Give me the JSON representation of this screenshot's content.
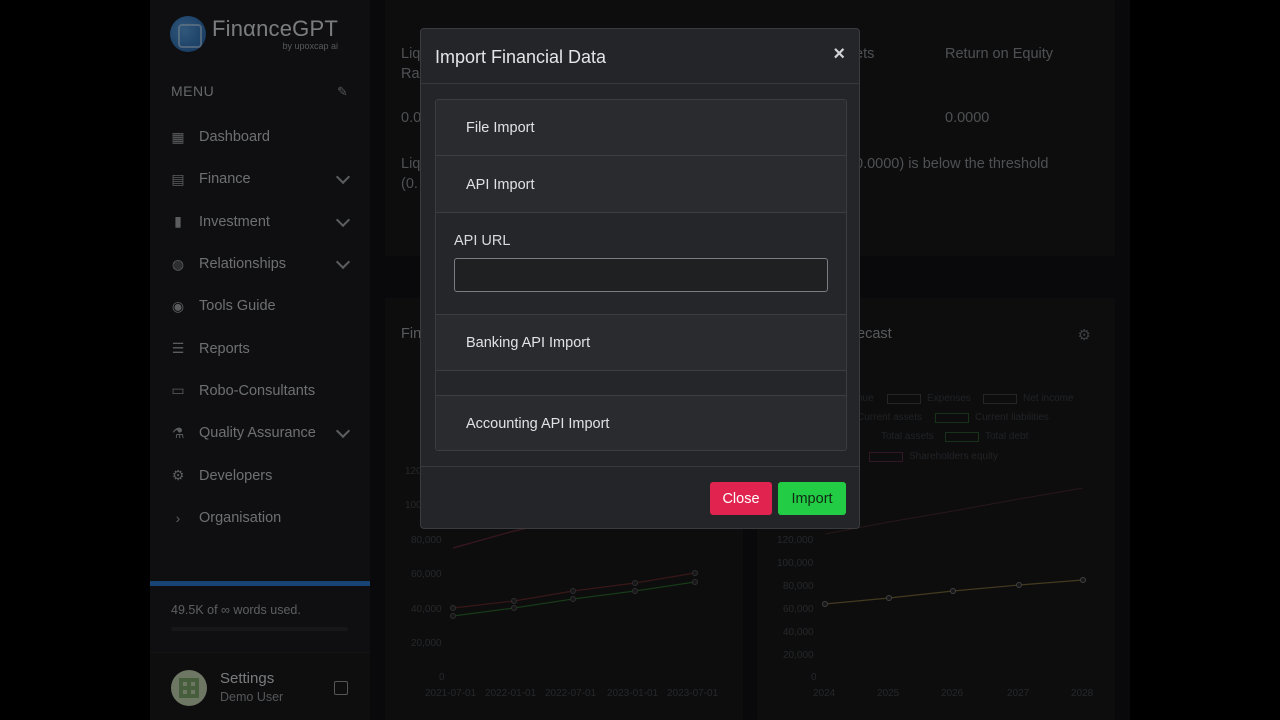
{
  "app": {
    "name": "FinαnceGPT",
    "tagline": "by upoxcap ai"
  },
  "sidebar": {
    "menu_label": "MENU",
    "items": [
      {
        "label": "Dashboard",
        "icon": "grid-icon",
        "glyph": "▦",
        "has_children": false
      },
      {
        "label": "Finance",
        "icon": "wallet-icon",
        "glyph": "▤",
        "has_children": true
      },
      {
        "label": "Investment",
        "icon": "bar-chart-icon",
        "glyph": "▮",
        "has_children": true
      },
      {
        "label": "Relationships",
        "icon": "palette-icon",
        "glyph": "◍",
        "has_children": true
      },
      {
        "label": "Tools Guide",
        "icon": "compass-icon",
        "glyph": "◉",
        "has_children": false
      },
      {
        "label": "Reports",
        "icon": "document-icon",
        "glyph": "☰",
        "has_children": false
      },
      {
        "label": "Robo-Consultants",
        "icon": "chat-icon",
        "glyph": "▭",
        "has_children": false
      },
      {
        "label": "Quality Assurance",
        "icon": "flask-icon",
        "glyph": "⚗",
        "has_children": true
      },
      {
        "label": "Developers",
        "icon": "gear-icon",
        "glyph": "⚙",
        "has_children": false
      },
      {
        "label": "Organisation",
        "icon": "chevron-right-icon",
        "glyph": "›",
        "has_children": false
      }
    ],
    "usage_text": "49.5K of ∞ words used.",
    "settings_label": "Settings",
    "user_name": "Demo User"
  },
  "background": {
    "table_headers": [
      "Liq",
      "Ra",
      "ets",
      "Return on Equity"
    ],
    "table_values": [
      "0.0",
      "0.0000"
    ],
    "alert_text_left": "Liq",
    "alert_text_left2": "(0.",
    "alert_text_right": "0.0000) is below the threshold",
    "left_chart_title": "Fin",
    "right_chart_title": "ecast",
    "left_y_ticks": [
      "120",
      "100",
      "80,000",
      "60,000",
      "40,000",
      "20,000",
      "0"
    ],
    "left_x_ticks": [
      "2021-07-01",
      "2022-01-01",
      "2022-07-01",
      "2023-01-01",
      "2023-07-01"
    ],
    "right_y_ticks": [
      "120,000",
      "100,000",
      "80,000",
      "60,000",
      "40,000",
      "20,000",
      "0"
    ],
    "right_x_ticks": [
      "2024",
      "2025",
      "2026",
      "2027",
      "2028"
    ],
    "legend": [
      "nue",
      "Expenses",
      "Net income",
      "Current assets",
      "Current liabilities",
      "Total assets",
      "Total debt",
      "Shareholders equity"
    ]
  },
  "modal": {
    "title": "Import Financial Data",
    "close_glyph": "×",
    "sections": {
      "file_import": "File Import",
      "api_import": "API Import",
      "banking_api_import": "Banking API Import",
      "accounting_api_import": "Accounting API Import"
    },
    "api_url_label": "API URL",
    "api_url_value": "",
    "close_button": "Close",
    "import_button": "Import"
  },
  "colors": {
    "primary_accent": "#2d7bd6",
    "danger": "#e0244f",
    "success": "#22cc44",
    "modal_bg": "#242528"
  }
}
